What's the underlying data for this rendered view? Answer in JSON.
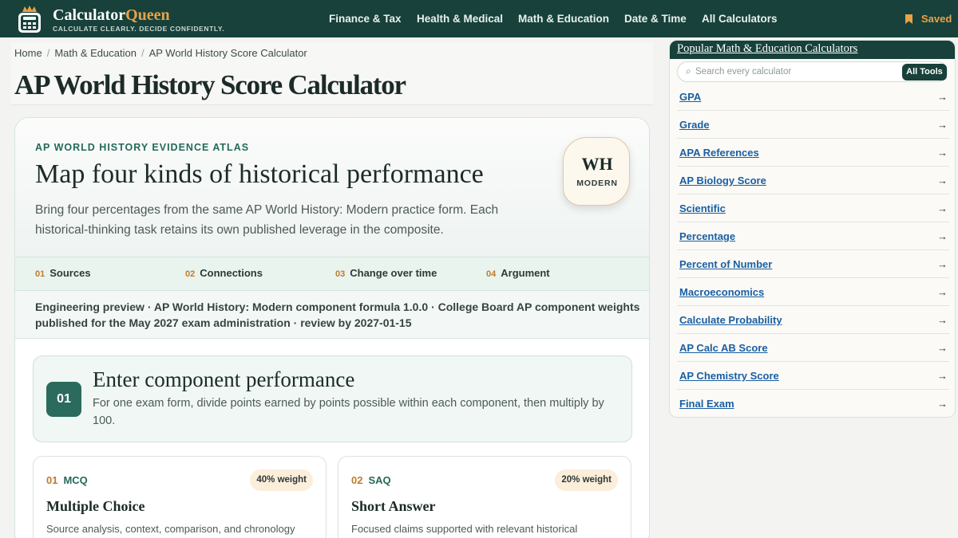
{
  "brand": {
    "name_part1": "Calculator",
    "name_part2": "Queen",
    "tagline": "CALCULATE CLEARLY. DECIDE CONFIDENTLY.",
    "accent_color": "#e8a24a",
    "bar_color": "#17413a"
  },
  "nav": {
    "items": [
      "Finance & Tax",
      "Health & Medical",
      "Math & Education",
      "Date & Time",
      "All Calculators"
    ],
    "saved_label": "Saved",
    "saved_icon": "bookmark-icon"
  },
  "breadcrumb": [
    "Home",
    "Math & Education",
    "AP World History Score Calculator"
  ],
  "page_title": "AP World History Score Calculator",
  "hero": {
    "eyebrow": "AP WORLD HISTORY EVIDENCE ATLAS",
    "title": "Map four kinds of historical performance",
    "description": "Bring four percentages from the same AP World History: Modern practice form. Each historical-thinking task retains its own published leverage in the composite.",
    "badge_main": "WH",
    "badge_sub": "MODERN"
  },
  "strip": [
    {
      "num": "01",
      "label": "Sources"
    },
    {
      "num": "02",
      "label": "Connections"
    },
    {
      "num": "03",
      "label": "Change over time"
    },
    {
      "num": "04",
      "label": "Argument"
    }
  ],
  "preview_note": "Engineering preview · AP World History: Modern component formula 1.0.0 · College Board AP component weights published for the May 2027 exam administration · review by 2027-01-15",
  "step": {
    "num": "01",
    "title": "Enter component performance",
    "description": "For one exam form, divide points earned by points possible within each component, then multiply by 100."
  },
  "components": [
    {
      "num": "01",
      "code": "MCQ",
      "weight": "40% weight",
      "title": "Multiple Choice",
      "description": "Source analysis, context, comparison, and chronology"
    },
    {
      "num": "02",
      "code": "SAQ",
      "weight": "20% weight",
      "title": "Short Answer",
      "description": "Focused claims supported with relevant historical"
    }
  ],
  "sidebar": {
    "title": "Popular Math & Education Calculators",
    "search_placeholder": "Search every calculator",
    "search_value": "",
    "all_tools_label": "All Tools",
    "arrow": "→",
    "items": [
      "GPA",
      "Grade",
      "APA References",
      "AP Biology Score",
      "Scientific",
      "Percentage",
      "Percent of Number",
      "Macroeconomics",
      "Calculate Probability",
      "AP Calc AB Score",
      "AP Chemistry Score",
      "Final Exam"
    ]
  }
}
